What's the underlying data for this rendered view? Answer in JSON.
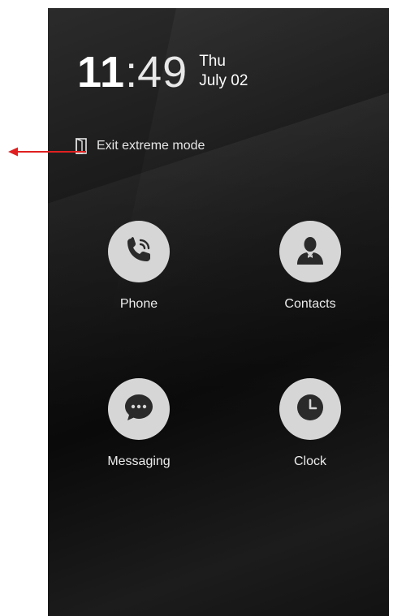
{
  "status": {
    "time_hours": "11",
    "time_separator": ":",
    "time_minutes": "49",
    "day": "Thu",
    "date": "July 02"
  },
  "exit_mode": {
    "label": "Exit extreme mode",
    "icon": "door-exit-icon"
  },
  "apps": [
    {
      "label": "Phone",
      "icon": "phone-icon"
    },
    {
      "label": "Contacts",
      "icon": "contact-person-icon"
    },
    {
      "label": "Messaging",
      "icon": "chat-bubble-icon"
    },
    {
      "label": "Clock",
      "icon": "clock-icon"
    }
  ],
  "annotation": {
    "arrow_color": "#e02020",
    "icon": "red-arrow-icon"
  },
  "colors": {
    "app_circle": "#d6d6d6",
    "app_glyph": "#2a2a2a",
    "text": "#ececec"
  }
}
